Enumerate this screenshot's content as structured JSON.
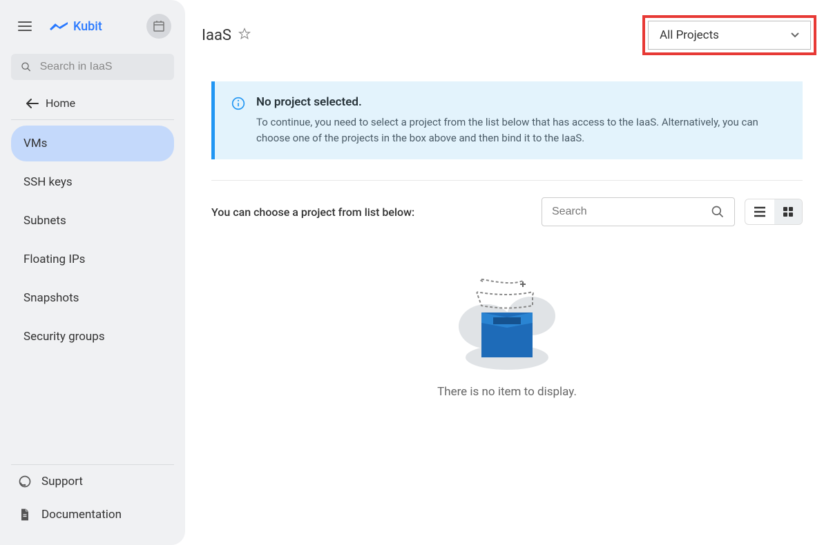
{
  "brand": {
    "name": "Kubit"
  },
  "search": {
    "placeholder": "Search in IaaS"
  },
  "nav": {
    "home": "Home",
    "items": [
      {
        "label": "VMs",
        "active": true
      },
      {
        "label": "SSH keys",
        "active": false
      },
      {
        "label": "Subnets",
        "active": false
      },
      {
        "label": "Floating IPs",
        "active": false
      },
      {
        "label": "Snapshots",
        "active": false
      },
      {
        "label": "Security groups",
        "active": false
      }
    ]
  },
  "footer": {
    "support": "Support",
    "documentation": "Documentation"
  },
  "header": {
    "title": "IaaS",
    "project_selector": "All Projects"
  },
  "banner": {
    "title": "No project selected.",
    "text": "To continue, you need to select a project from the list below that has access to the IaaS. Alternatively, you can choose one of the projects in the box above and then bind it to the IaaS."
  },
  "list": {
    "prompt": "You can choose a project from list below:",
    "search_placeholder": "Search",
    "empty_text": "There is no item to display."
  }
}
